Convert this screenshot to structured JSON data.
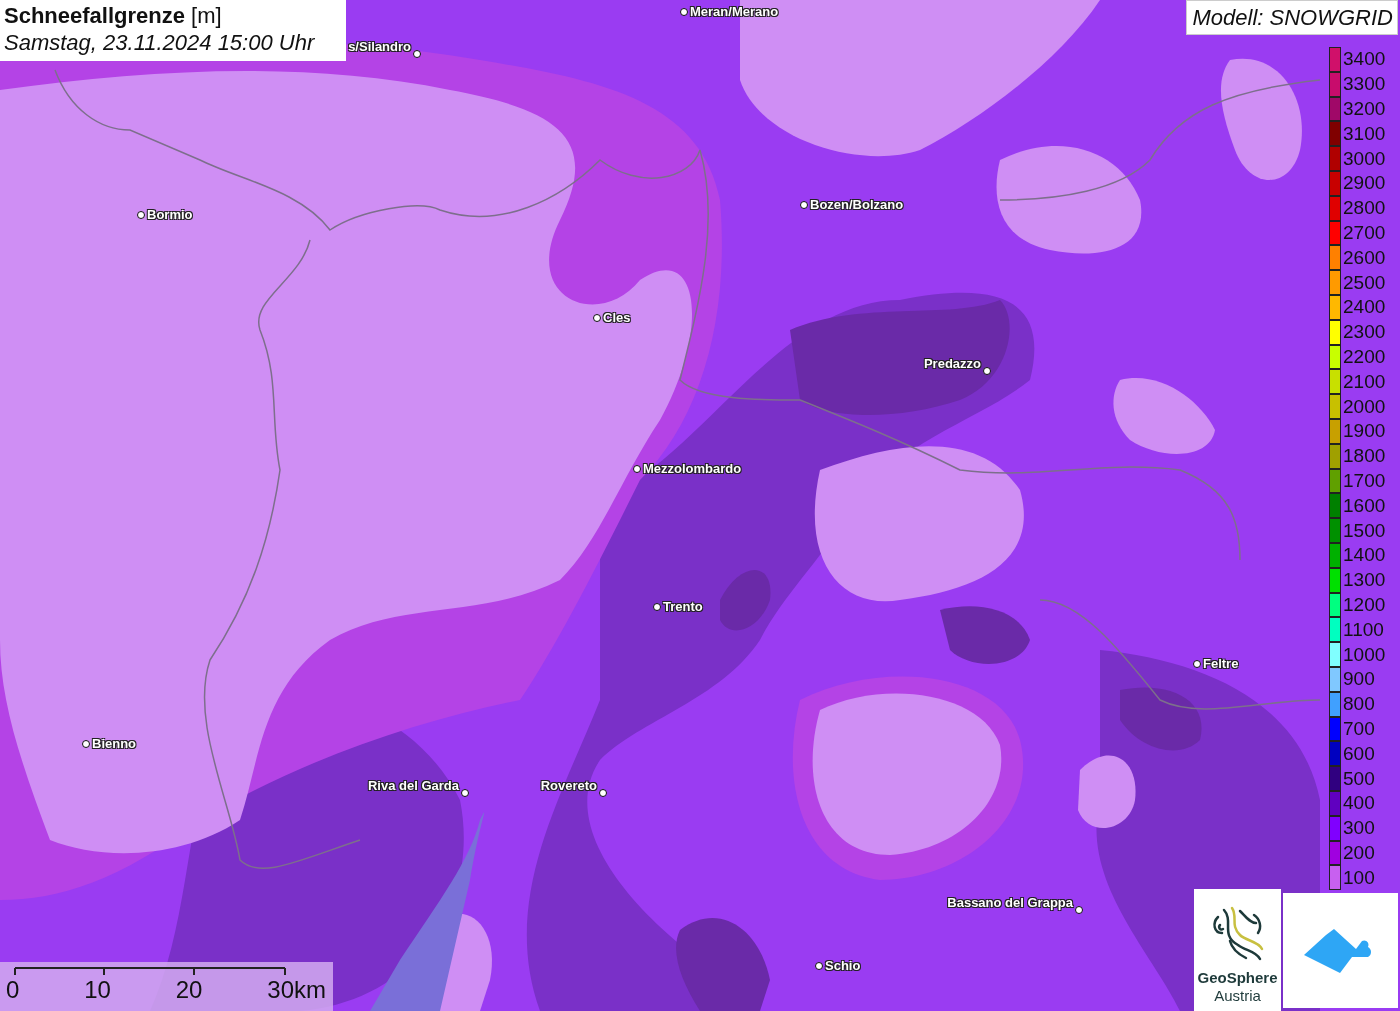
{
  "title": {
    "text": "Schneefallgrenze",
    "unit": "[m]"
  },
  "datetime": "Samstag, 23.11.2024 15:00 Uhr",
  "model": "Modell: SNOWGRID",
  "cities": [
    {
      "name": "Meran/Merano"
    },
    {
      "name": "s/Silandro"
    },
    {
      "name": "Bormio"
    },
    {
      "name": "Bozen/Bolzano"
    },
    {
      "name": "Cles"
    },
    {
      "name": "Predazzo"
    },
    {
      "name": "Mezzolombardo"
    },
    {
      "name": "Trento"
    },
    {
      "name": "Feltre"
    },
    {
      "name": "Bienno"
    },
    {
      "name": "Riva del Garda"
    },
    {
      "name": "Rovereto"
    },
    {
      "name": "Bassano del Grappa"
    },
    {
      "name": "Schio"
    }
  ],
  "legend": [
    {
      "label": "3400",
      "color": "#d0106a"
    },
    {
      "label": "3300",
      "color": "#c80c6c"
    },
    {
      "label": "3200",
      "color": "#a00868"
    },
    {
      "label": "3100",
      "color": "#800000"
    },
    {
      "label": "3000",
      "color": "#b00000"
    },
    {
      "label": "2900",
      "color": "#c80000"
    },
    {
      "label": "2800",
      "color": "#e00000"
    },
    {
      "label": "2700",
      "color": "#ff0000"
    },
    {
      "label": "2600",
      "color": "#ff8000"
    },
    {
      "label": "2500",
      "color": "#ff9a00"
    },
    {
      "label": "2400",
      "color": "#ffb800"
    },
    {
      "label": "2300",
      "color": "#ffff00"
    },
    {
      "label": "2200",
      "color": "#c8ff00"
    },
    {
      "label": "2100",
      "color": "#c8e000"
    },
    {
      "label": "2000",
      "color": "#c8c000"
    },
    {
      "label": "1900",
      "color": "#c8a000"
    },
    {
      "label": "1800",
      "color": "#a0a000"
    },
    {
      "label": "1700",
      "color": "#60a000"
    },
    {
      "label": "1600",
      "color": "#008000"
    },
    {
      "label": "1500",
      "color": "#009000"
    },
    {
      "label": "1400",
      "color": "#00b000"
    },
    {
      "label": "1300",
      "color": "#00e000"
    },
    {
      "label": "1200",
      "color": "#00ff80"
    },
    {
      "label": "1100",
      "color": "#00ffc0"
    },
    {
      "label": "1000",
      "color": "#80ffff"
    },
    {
      "label": "900",
      "color": "#80c8ff"
    },
    {
      "label": "800",
      "color": "#40a0ff"
    },
    {
      "label": "700",
      "color": "#0000ff"
    },
    {
      "label": "600",
      "color": "#0000c0"
    },
    {
      "label": "500",
      "color": "#300080"
    },
    {
      "label": "400",
      "color": "#6000c0"
    },
    {
      "label": "300",
      "color": "#8000ff"
    },
    {
      "label": "200",
      "color": "#a000e0"
    },
    {
      "label": "100",
      "color": "#c860f0"
    }
  ],
  "scale_bar": {
    "ticks": [
      "0",
      "10",
      "20",
      "30km"
    ]
  },
  "logo": {
    "name": "GeoSphere",
    "sub": "Austria"
  }
}
